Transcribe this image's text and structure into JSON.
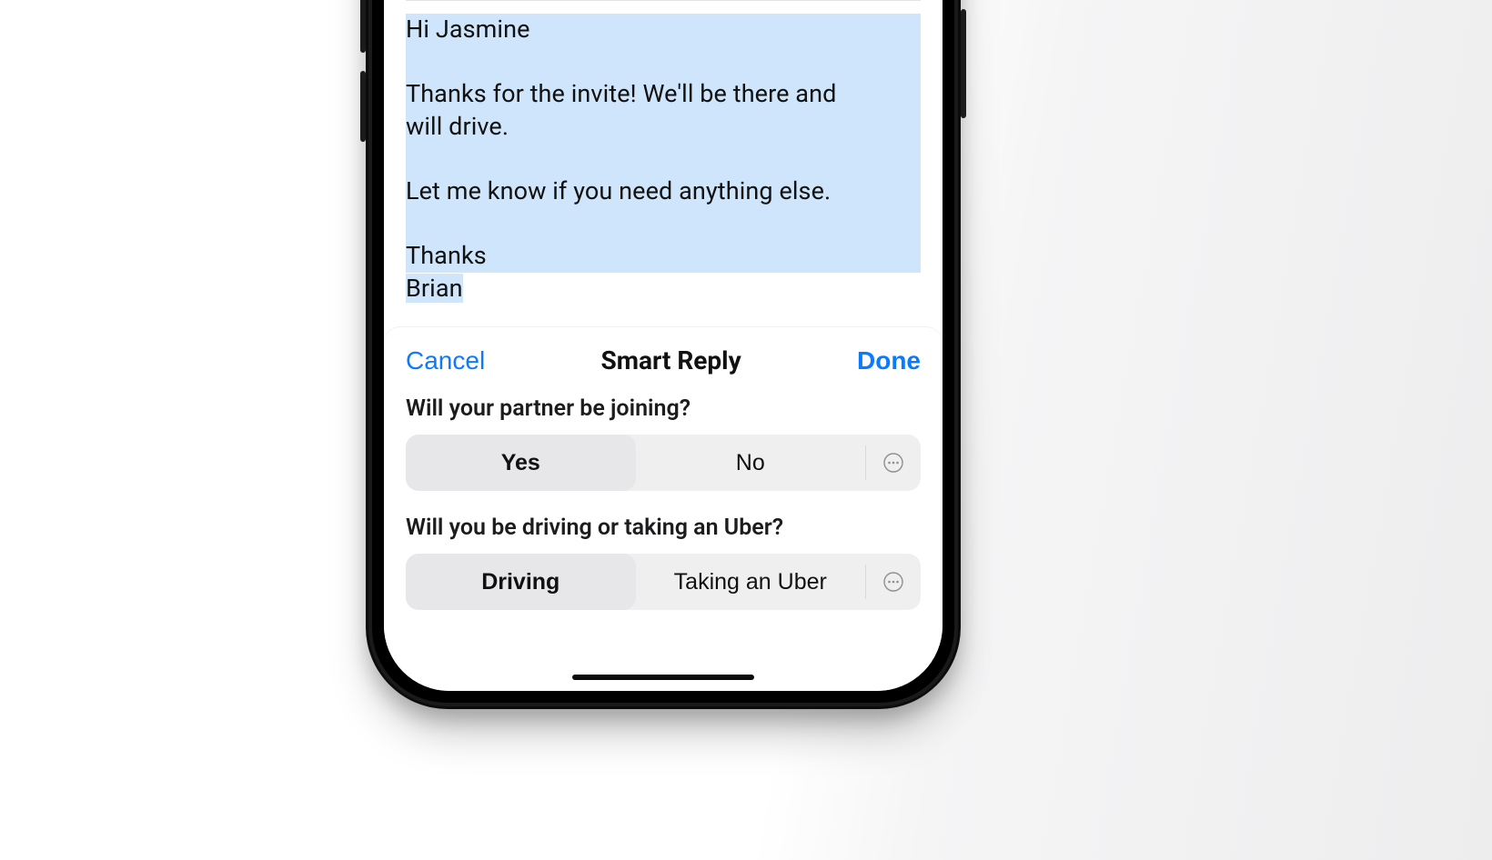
{
  "email": {
    "line1": "Hi Jasmine",
    "blank1": " ",
    "line2": "Thanks for the invite! We'll be there and",
    "line3": "will drive.",
    "blank2": " ",
    "line4": "Let me know if you need anything else.",
    "blank3": " ",
    "line5": "Thanks",
    "line6": "Brian"
  },
  "sheet": {
    "cancel": "Cancel",
    "title": "Smart Reply",
    "done": "Done",
    "questions": [
      {
        "prompt": "Will your partner be joining?",
        "opt1": "Yes",
        "opt2": "No",
        "selected": 0
      },
      {
        "prompt": "Will you be driving or taking an Uber?",
        "opt1": "Driving",
        "opt2": "Taking an Uber",
        "selected": 0
      }
    ]
  }
}
